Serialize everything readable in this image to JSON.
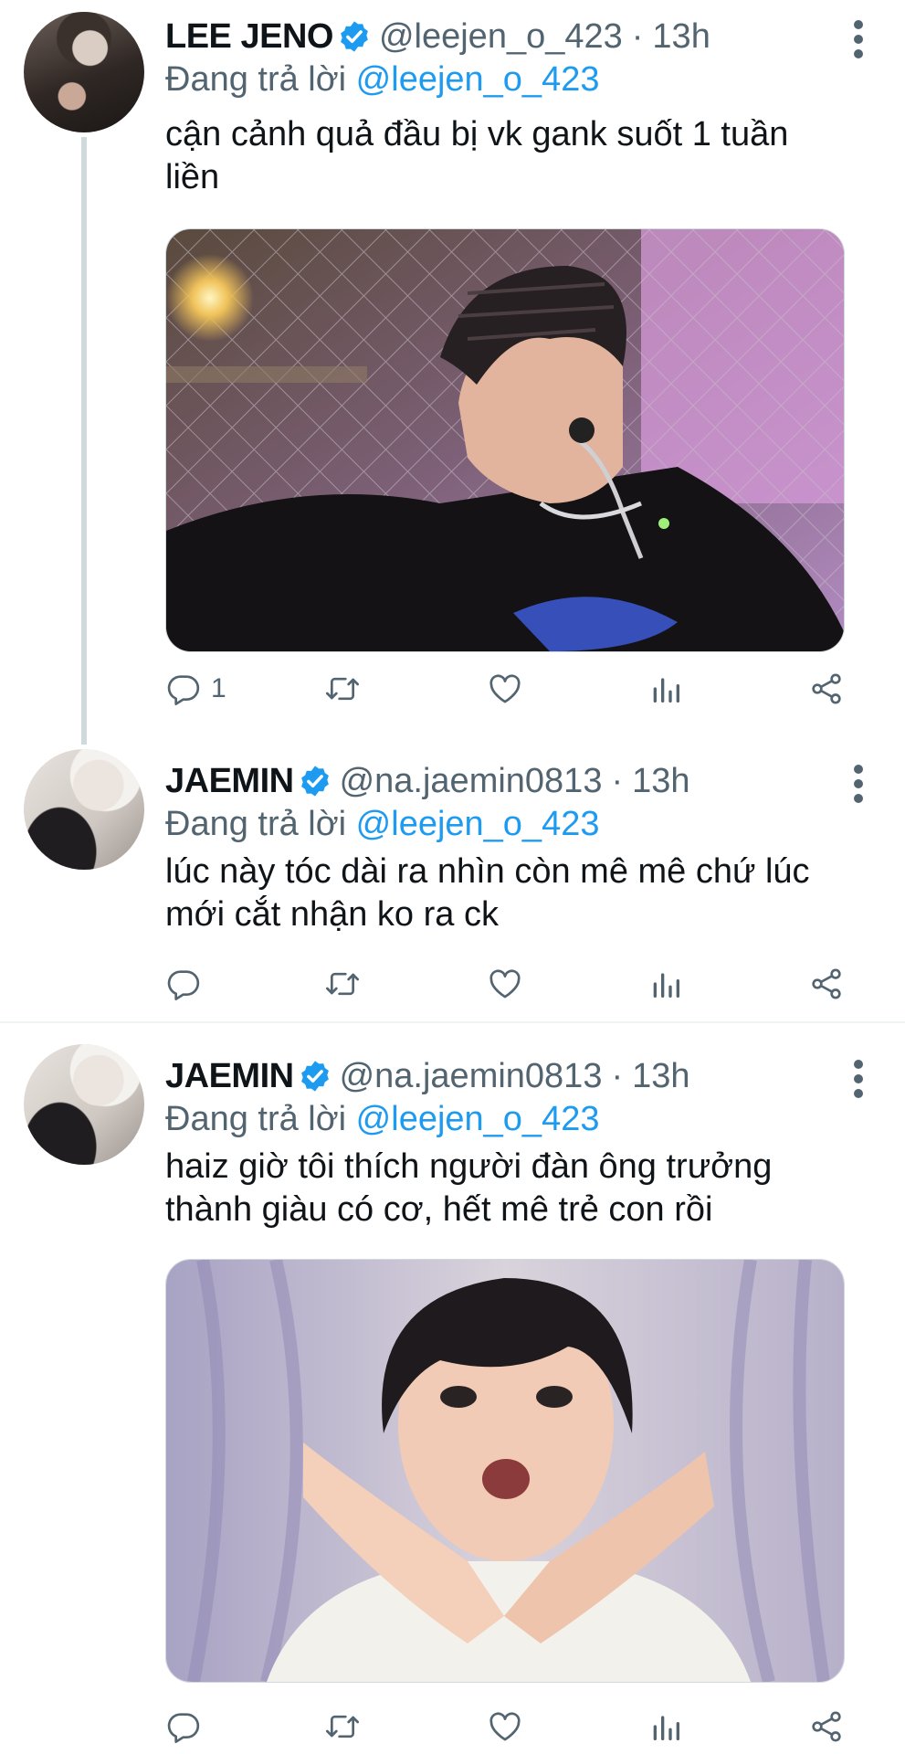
{
  "colors": {
    "accent": "#1d9bf0",
    "muted": "#536471",
    "text": "#0f1419"
  },
  "tweets": [
    {
      "name": "LEE JENO",
      "handle": "@leejen_o_423",
      "separator": "·",
      "time": "13h",
      "replying_prefix": "Đang trả lời",
      "replying_to": "@leejen_o_423",
      "text": "cận cảnh quả đầu bị vk gank suốt 1 tuần liền",
      "reply_count": "1",
      "has_media": true
    },
    {
      "name": "JAEMIN",
      "handle": "@na.jaemin0813",
      "separator": "·",
      "time": "13h",
      "replying_prefix": "Đang trả lời",
      "replying_to": "@leejen_o_423",
      "text": "lúc này tóc dài ra nhìn còn mê mê chứ lúc mới cắt nhận ko ra ck",
      "reply_count": "",
      "has_media": false
    },
    {
      "name": "JAEMIN",
      "handle": "@na.jaemin0813",
      "separator": "·",
      "time": "13h",
      "replying_prefix": "Đang trả lời",
      "replying_to": "@leejen_o_423",
      "text": "haiz giờ tôi thích người đàn ông trưởng thành giàu có cơ, hết mê trẻ con rồi",
      "reply_count": "",
      "has_media": true
    }
  ],
  "icons": [
    "reply-icon",
    "retweet-icon",
    "like-icon",
    "analytics-icon",
    "share-icon",
    "verified-badge-icon",
    "more-options-icon"
  ]
}
